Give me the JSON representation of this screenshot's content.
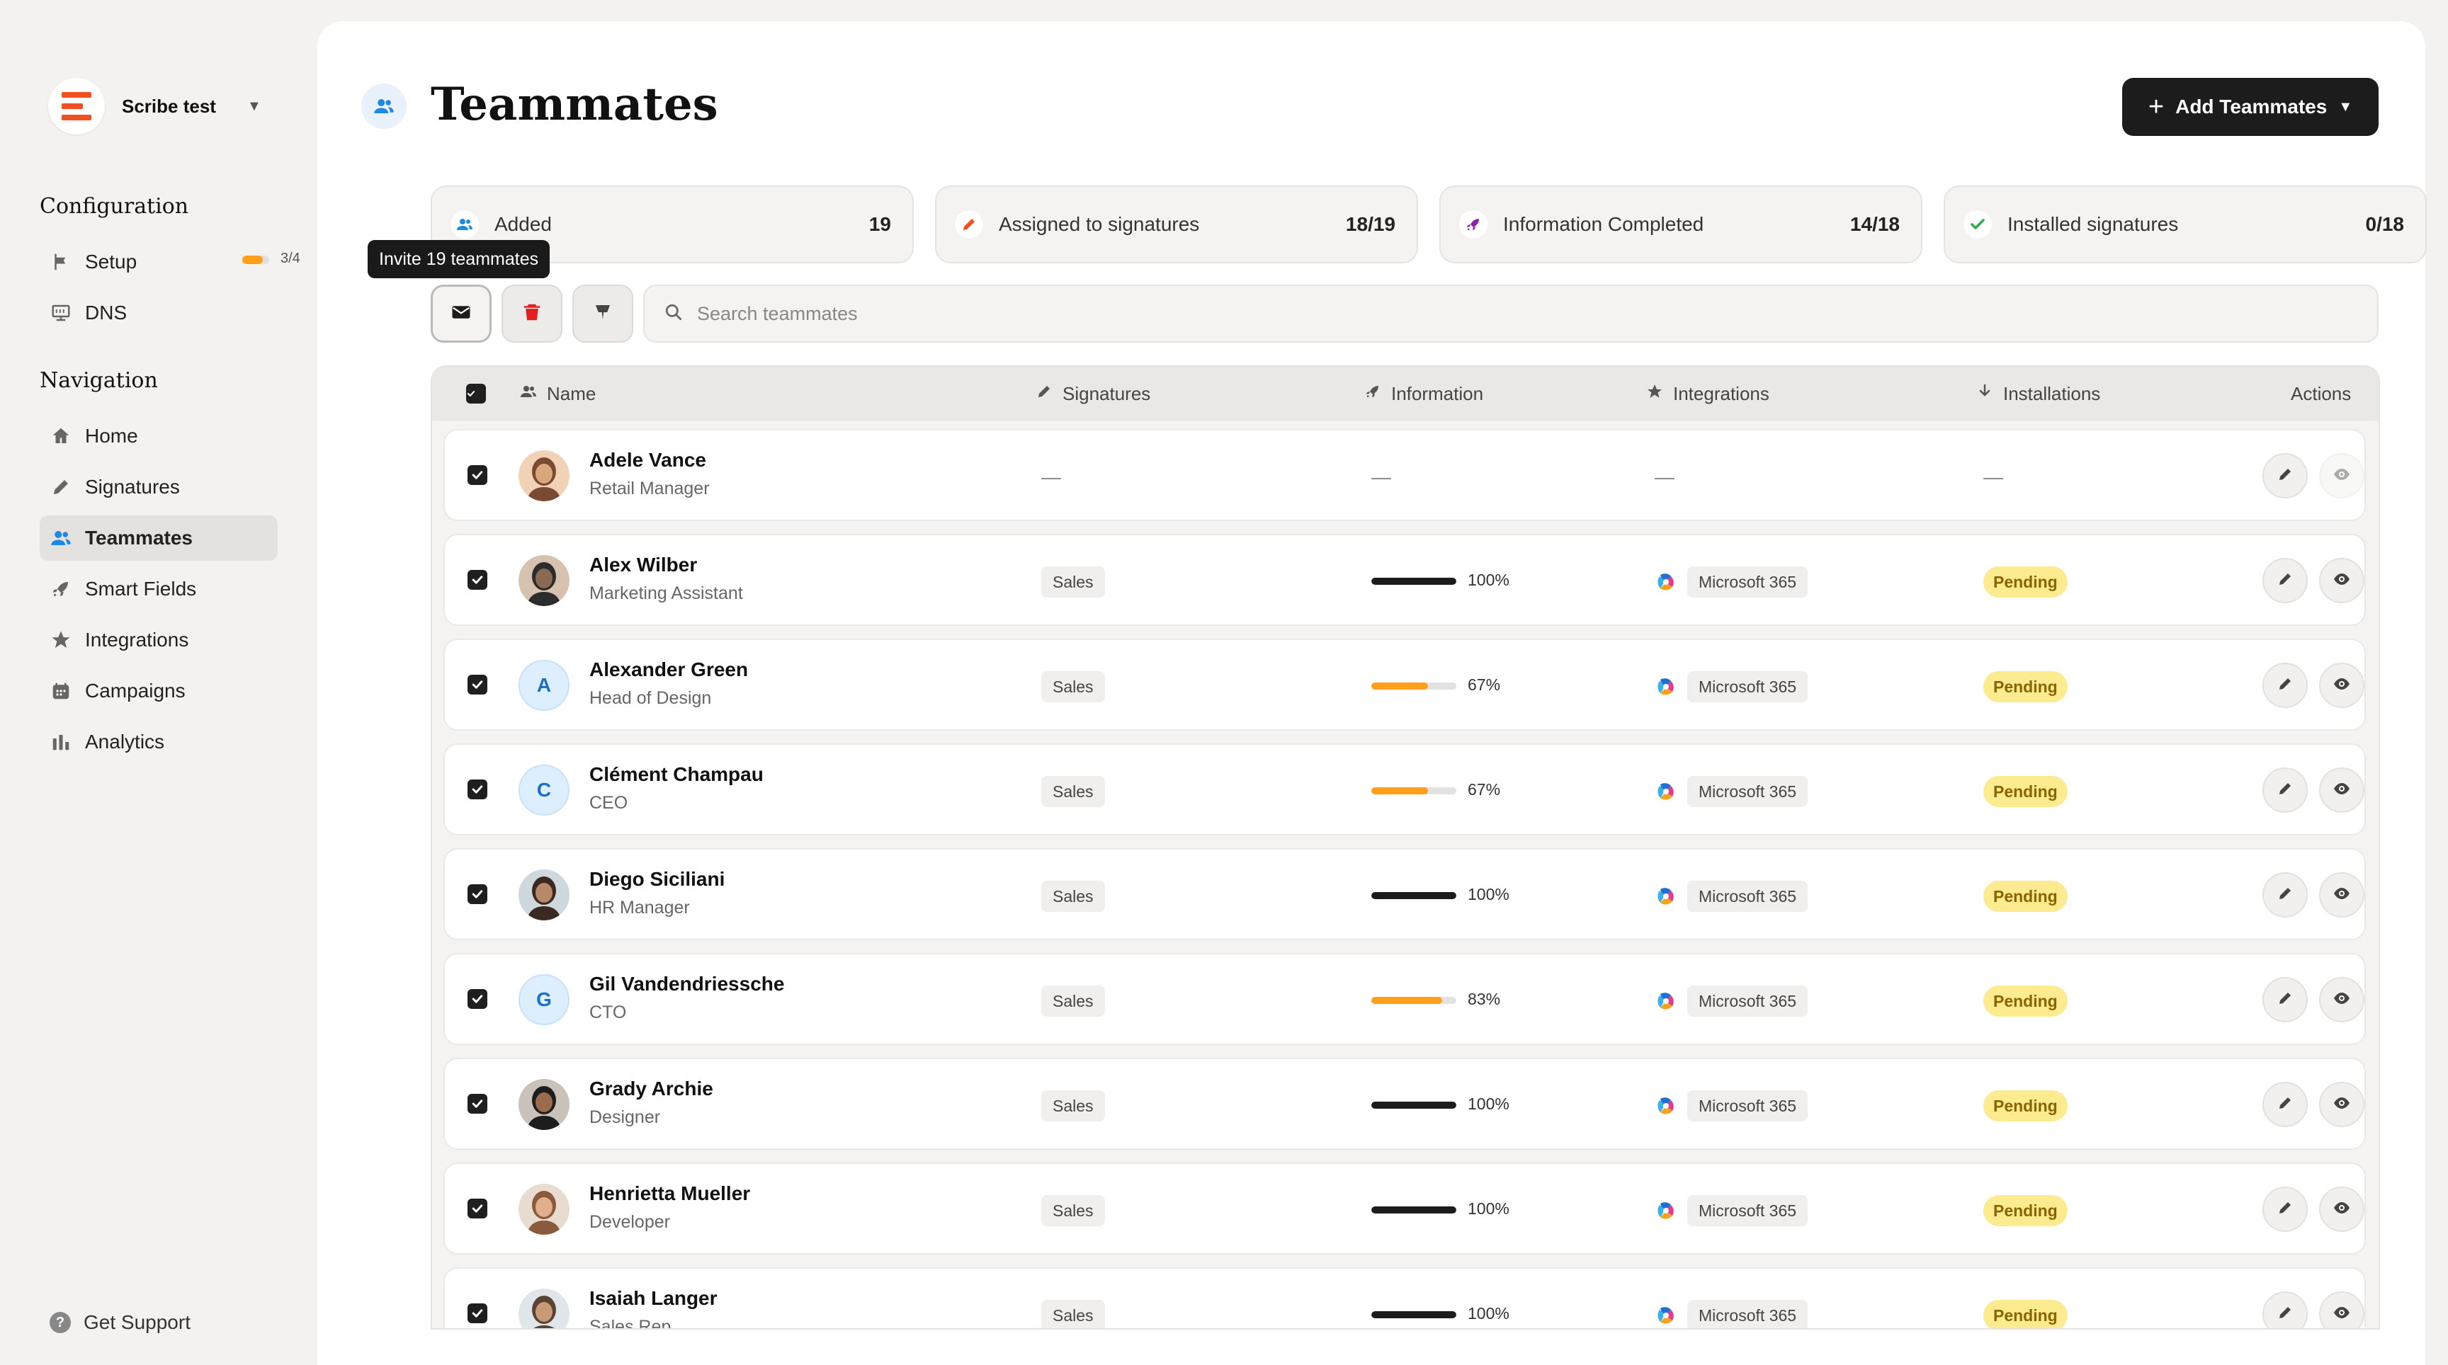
{
  "workspace": {
    "name": "Scribe test"
  },
  "sidebar": {
    "configuration_title": "Configuration",
    "setup": {
      "label": "Setup",
      "progress": 0.75,
      "count": "3/4"
    },
    "dns": {
      "label": "DNS"
    },
    "navigation_title": "Navigation",
    "nav": [
      {
        "label": "Home",
        "icon": "home-icon"
      },
      {
        "label": "Signatures",
        "icon": "pen-icon"
      },
      {
        "label": "Teammates",
        "icon": "users-icon",
        "active": true
      },
      {
        "label": "Smart Fields",
        "icon": "rocket-icon"
      },
      {
        "label": "Integrations",
        "icon": "star-icon"
      },
      {
        "label": "Campaigns",
        "icon": "calendar-icon"
      },
      {
        "label": "Analytics",
        "icon": "bar-chart-icon"
      }
    ],
    "support": "Get Support"
  },
  "header": {
    "title": "Teammates",
    "add_button": "Add Teammates"
  },
  "stats": [
    {
      "label": "Added",
      "value": "19",
      "icon": "users-icon"
    },
    {
      "label": "Assigned to signatures",
      "value": "18/19",
      "icon": "pen-icon"
    },
    {
      "label": "Information Completed",
      "value": "14/18",
      "icon": "rocket-icon"
    },
    {
      "label": "Installed signatures",
      "value": "0/18",
      "icon": "check-icon"
    }
  ],
  "toolbar": {
    "tooltip": "Invite 19 teammates",
    "search_placeholder": "Search teammates"
  },
  "table": {
    "columns": {
      "name": "Name",
      "signatures": "Signatures",
      "information": "Information",
      "integrations": "Integrations",
      "installations": "Installations",
      "actions": "Actions"
    },
    "empty_value": "—",
    "rows": [
      {
        "name": "Adele Vance",
        "role": "Retail Manager",
        "avatar": "photo",
        "empty": true
      },
      {
        "name": "Alex Wilber",
        "role": "Marketing Assistant",
        "avatar": "photo",
        "signature": "Sales",
        "info": 100,
        "info_label": "100%",
        "integration": "Microsoft 365",
        "status": "Pending"
      },
      {
        "name": "Alexander Green",
        "role": "Head of Design",
        "avatar": "A",
        "signature": "Sales",
        "info": 67,
        "info_label": "67%",
        "integration": "Microsoft 365",
        "status": "Pending"
      },
      {
        "name": "Clément Champau",
        "role": "CEO",
        "avatar": "C",
        "signature": "Sales",
        "info": 67,
        "info_label": "67%",
        "integration": "Microsoft 365",
        "status": "Pending"
      },
      {
        "name": "Diego Siciliani",
        "role": "HR Manager",
        "avatar": "photo",
        "signature": "Sales",
        "info": 100,
        "info_label": "100%",
        "integration": "Microsoft 365",
        "status": "Pending"
      },
      {
        "name": "Gil Vandendriessche",
        "role": "CTO",
        "avatar": "G",
        "signature": "Sales",
        "info": 83,
        "info_label": "83%",
        "integration": "Microsoft 365",
        "status": "Pending"
      },
      {
        "name": "Grady Archie",
        "role": "Designer",
        "avatar": "photo",
        "signature": "Sales",
        "info": 100,
        "info_label": "100%",
        "integration": "Microsoft 365",
        "status": "Pending"
      },
      {
        "name": "Henrietta Mueller",
        "role": "Developer",
        "avatar": "photo",
        "signature": "Sales",
        "info": 100,
        "info_label": "100%",
        "integration": "Microsoft 365",
        "status": "Pending"
      },
      {
        "name": "Isaiah Langer",
        "role": "Sales Rep",
        "avatar": "photo",
        "signature": "Sales",
        "info": 100,
        "info_label": "100%",
        "integration": "Microsoft 365",
        "status": "Pending"
      }
    ]
  },
  "colors": {
    "accent_blue": "#1e88e5",
    "progress_full": "#1c1c1c",
    "progress_partial": "#ff9f1a",
    "pending_bg": "#fdeb8f",
    "brand": "#f24e1e"
  }
}
